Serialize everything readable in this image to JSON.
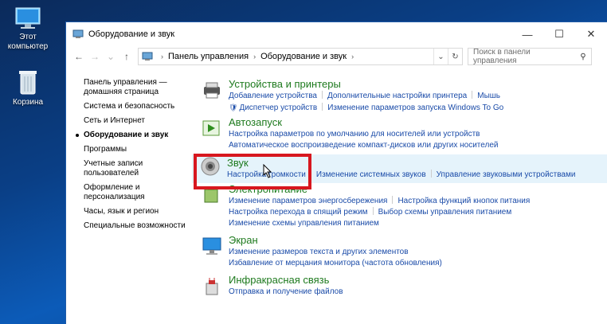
{
  "desktop": {
    "computer_label": "Этот компьютер",
    "recycle_label": "Корзина"
  },
  "window": {
    "title": "Оборудование и звук",
    "minimize": "—",
    "maximize": "☐",
    "close": "✕"
  },
  "address": {
    "crumb1": "Панель управления",
    "crumb2": "Оборудование и звук",
    "search_placeholder": "Поиск в панели управления"
  },
  "leftnav": [
    "Панель управления — домашняя страница",
    "Система и безопасность",
    "Сеть и Интернет",
    "Оборудование и звук",
    "Программы",
    "Учетные записи пользователей",
    "Оформление и персонализация",
    "Часы, язык и регион",
    "Специальные возможности"
  ],
  "sections": {
    "devices": {
      "title": "Устройства и принтеры",
      "links": [
        "Добавление устройства",
        "Дополнительные настройки принтера",
        "Мышь",
        "Диспетчер устройств",
        "Изменение параметров запуска Windows To Go"
      ]
    },
    "autoplay": {
      "title": "Автозапуск",
      "links": [
        "Настройка параметров по умолчанию для носителей или устройств",
        "Автоматическое воспроизведение компакт-дисков или других носителей"
      ]
    },
    "sound": {
      "title": "Звук",
      "links": [
        "Настройка громкости",
        "Изменение системных звуков",
        "Управление звуковыми устройствами"
      ]
    },
    "power": {
      "title": "Электропитание",
      "links": [
        "Изменение параметров энергосбережения",
        "Настройка функций кнопок питания",
        "Настройка перехода в спящий режим",
        "Выбор схемы управления питанием",
        "Изменение схемы управления питанием"
      ]
    },
    "display": {
      "title": "Экран",
      "links": [
        "Изменение размеров текста и других элементов",
        "Избавление от мерцания монитора (частота обновления)"
      ]
    },
    "infrared": {
      "title": "Инфракрасная связь",
      "links": [
        "Отправка и получение файлов"
      ]
    }
  },
  "colors": {
    "link": "#1a4ba8",
    "section_title": "#1e7a1e",
    "highlight_box": "#d7171f"
  }
}
